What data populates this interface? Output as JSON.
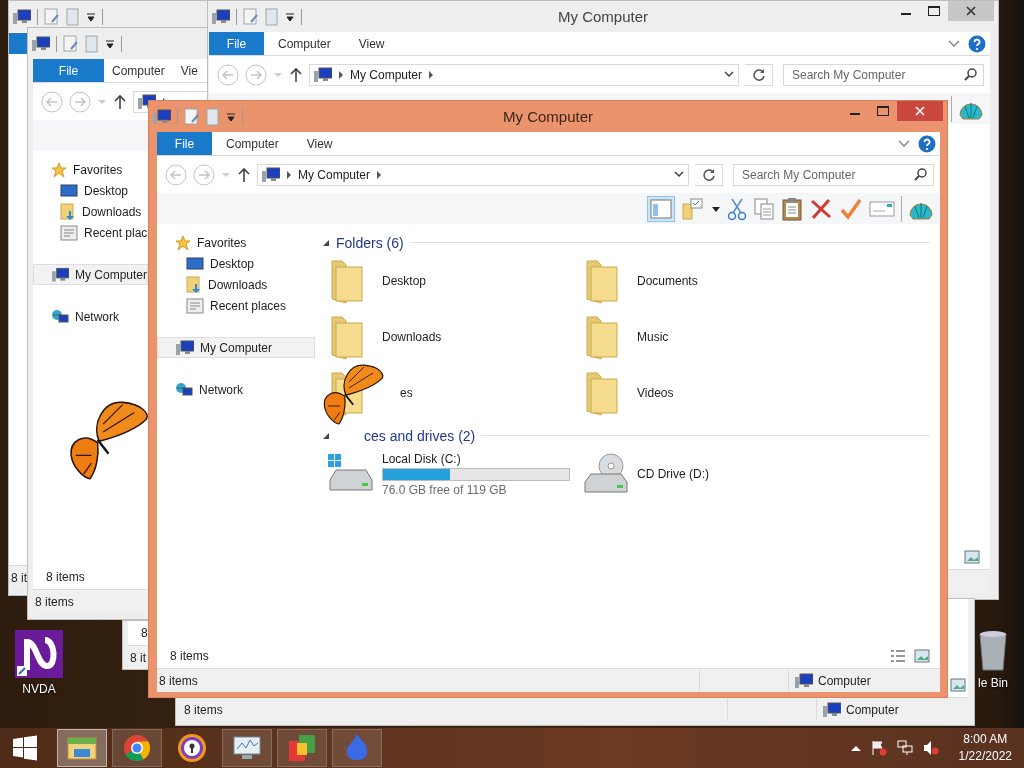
{
  "windows": [
    {
      "kind": "main",
      "title": "My Computer",
      "tabs": [
        {
          "kind": "file",
          "label": "File"
        },
        {
          "kind": "tab",
          "label": "Computer"
        },
        {
          "kind": "tab",
          "label": "View"
        }
      ],
      "address": "My Computer",
      "search_placeholder": "Search My Computer",
      "nav": [
        {
          "label": "Favorites",
          "kind": "favorites",
          "selected": false,
          "children": [
            {
              "label": "Desktop",
              "kind": "desktop",
              "selected": false
            },
            {
              "label": "Downloads",
              "kind": "downloads",
              "selected": false
            },
            {
              "label": "Recent places",
              "kind": "recent",
              "selected": false
            }
          ]
        },
        {
          "label": "My Computer",
          "kind": "computer",
          "selected": true
        },
        {
          "label": "Network",
          "kind": "network",
          "selected": false
        }
      ],
      "sections": [
        {
          "title": "Folders (6)",
          "obscured": false,
          "items": [
            {
              "label": "Desktop",
              "kind": "desktop",
              "obscured": false
            },
            {
              "label": "Documents",
              "kind": "documents",
              "obscured": false
            },
            {
              "label": "Downloads",
              "kind": "downloads",
              "obscured": false
            },
            {
              "label": "Music",
              "kind": "music",
              "obscured": false
            },
            {
              "label": "es",
              "kind": "pictures",
              "obscured": true
            },
            {
              "label": "Videos",
              "kind": "videos",
              "obscured": false
            }
          ]
        },
        {
          "title": "ces and drives (2)",
          "obscured": true,
          "items": [
            {
              "label": "Local Disk (C:)",
              "kind": "disk",
              "obscured": false,
              "level": 0.36,
              "detail": "76.0 GB free of 119 GB"
            },
            {
              "label": "CD Drive (D:)",
              "kind": "cd",
              "obscured": false
            }
          ]
        }
      ],
      "item_count": "8 items",
      "status": "8 items",
      "location": "Computer"
    },
    {
      "kind": "bottom",
      "status": "8 items",
      "location": "Computer"
    },
    {
      "kind": "stub",
      "item_count": "8",
      "status": "8 it"
    },
    {
      "kind": "top",
      "title": "My Computer",
      "tabs": [
        {
          "kind": "file",
          "label": "File"
        },
        {
          "kind": "tab",
          "label": "Computer"
        },
        {
          "kind": "tab",
          "label": "View"
        }
      ],
      "address": "My Computer",
      "search_placeholder": "Search My Computer"
    },
    {
      "kind": "left",
      "tabs": [
        {
          "kind": "file",
          "label": "File"
        },
        {
          "kind": "tab",
          "label": "Computer"
        },
        {
          "kind": "tab",
          "label": "Vie"
        }
      ],
      "nav": [
        {
          "label": "Favorites",
          "kind": "favorites",
          "selected": false,
          "children": [
            {
              "label": "Desktop",
              "kind": "desktop",
              "selected": false
            },
            {
              "label": "Downloads",
              "kind": "downloads",
              "selected": false
            },
            {
              "label": "Recent plac",
              "kind": "recent",
              "selected": false
            }
          ]
        },
        {
          "label": "My Computer",
          "kind": "computer",
          "selected": true
        },
        {
          "label": "Network",
          "kind": "network",
          "selected": false
        }
      ],
      "item_count": "8 items",
      "status": "8 items"
    },
    {
      "kind": "left_back",
      "status": "8 it"
    }
  ],
  "desktop_icons": [
    {
      "label": "NVDA",
      "kind": "nvda"
    },
    {
      "label": "le Bin",
      "kind": "recycle_bin"
    }
  ],
  "taskbar": {
    "apps": [
      {
        "kind": "explorer",
        "running": true,
        "selected": true
      },
      {
        "kind": "chrome",
        "running": true,
        "selected": false
      },
      {
        "kind": "shield",
        "running": false,
        "selected": false
      },
      {
        "kind": "monitor",
        "running": true,
        "selected": false
      },
      {
        "kind": "tiles",
        "running": true,
        "selected": false
      },
      {
        "kind": "flame",
        "running": true,
        "selected": false
      }
    ],
    "time": "8:00 AM",
    "date": "1/22/2022"
  }
}
